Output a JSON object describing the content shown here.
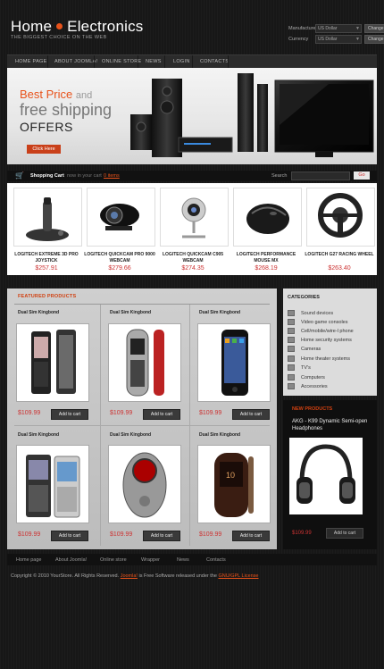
{
  "header": {
    "title_part1": "Home",
    "title_part2": "Electronics",
    "tagline": "THE BIGGEST CHOICE ON THE WEB",
    "manufacturer_label": "Manufacturer",
    "manufacturer_value": "US Dollar",
    "currency_label": "Currency",
    "currency_value": "US Dollar",
    "change_label": "Change"
  },
  "nav": [
    "HOME PAGE",
    "ABOUT JOOMLA!",
    "ONLINE STORE",
    "NEWS",
    "LOGIN",
    "CONTACTS"
  ],
  "banner": {
    "line1": "Best Price",
    "line1_and": "and",
    "line2": "free shipping",
    "line3": "OFFERS",
    "cta": "Click Here"
  },
  "cart": {
    "title": "Shopping Cart",
    "status": "now in your cart",
    "link": "0 items",
    "search_label": "Search",
    "search_button": "Go"
  },
  "strip_products": [
    {
      "name": "LOGITECH EXTREME 3D PRO JOYSTICK",
      "price": "$257.91"
    },
    {
      "name": "LOGITECH QUICKCAM PRO 9000 WEBCAM",
      "price": "$279.66"
    },
    {
      "name": "LOGITECH QUICKCAM C905 WEBCAM",
      "price": "$274.35"
    },
    {
      "name": "LOGITECH PERFORMANCE MOUSE MX",
      "price": "$268.19"
    },
    {
      "name": "LOGITECH G27 RACING WHEEL",
      "price": "$263.40"
    }
  ],
  "featured": {
    "title": "FEATURED PRODUCTS",
    "add_to_cart": "Add to cart",
    "items": [
      {
        "name": "Dual Sim Kingbond",
        "price": "$109.99"
      },
      {
        "name": "Dual Sim Kingbond",
        "price": "$109.99"
      },
      {
        "name": "Dual Sim Kingbond",
        "price": "$109.99"
      },
      {
        "name": "Dual Sim Kingbond",
        "price": "$109.99"
      },
      {
        "name": "Dual Sim Kingbond",
        "price": "$109.99"
      },
      {
        "name": "Dual Sim Kingbond",
        "price": "$109.99"
      }
    ]
  },
  "categories": {
    "title": "CATEGORIES",
    "items": [
      "Sound devices",
      "Video game consoles",
      "Cell/mobile/wire-l phone",
      "Home security systems",
      "Cameras",
      "Home theater systems",
      "TV's",
      "Computers",
      "Accessories"
    ]
  },
  "new_products": {
    "title": "NEW PRODUCTS",
    "name": "AKG - K99 Dynamic Semi-open Headphones",
    "price": "$109.99",
    "button": "Add to cart"
  },
  "footer": {
    "nav": [
      "Home page",
      "About Joomla!",
      "Online store",
      "Wrapper",
      "News",
      "Contacts"
    ],
    "copyright": "Copyright © 2010 YourStore.  All Rights Reserved.",
    "joomla_link": "Joomla!",
    "mid_text": "is Free Software released under the",
    "license_link": "GNU/GPL License"
  },
  "colors": {
    "accent": "#e8521a",
    "price": "#cc3333",
    "background": "#1a1a1a"
  }
}
